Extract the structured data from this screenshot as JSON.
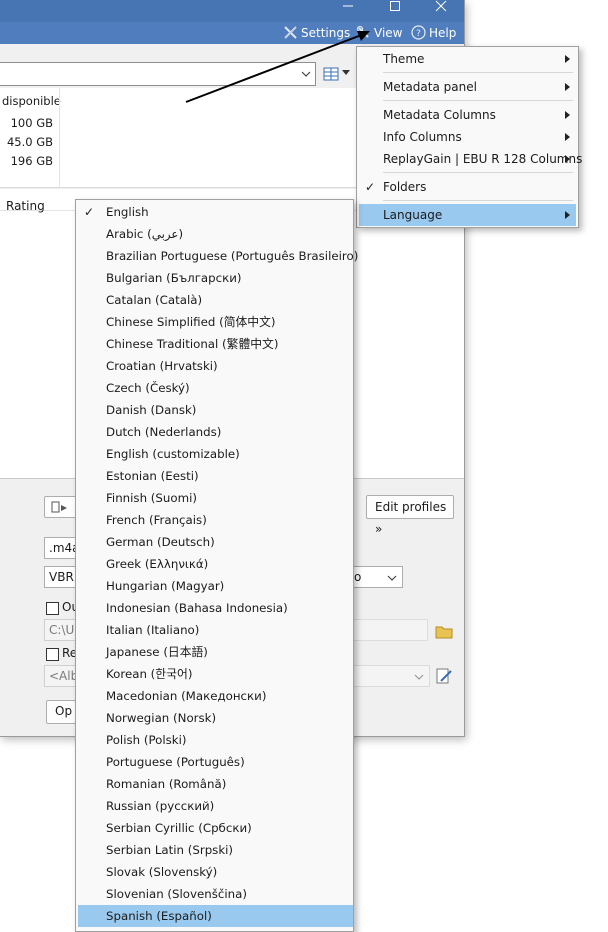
{
  "menubar": {
    "settings": "Settings",
    "view": "View",
    "help": "Help"
  },
  "drives": {
    "header": "disponible",
    "values": [
      "100 GB",
      "45.0 GB",
      "196 GB"
    ]
  },
  "list": {
    "rating_header": "Rating"
  },
  "bottom": {
    "edit_profiles": "Edit profiles »",
    "format_value": ".m4a",
    "mode_value": "VBR",
    "checkbox1_label": "Ou",
    "path_value": "C:\\U",
    "checkbox2_label": "Re",
    "pattern_value": "<Alb",
    "options_label": "Op",
    "mode2_value": "o"
  },
  "view_menu": {
    "items": [
      {
        "label": "Theme",
        "submenu": true
      },
      {
        "label": "Metadata panel",
        "submenu": true
      },
      {
        "label": "Metadata Columns",
        "submenu": true
      },
      {
        "label": "Info Columns",
        "submenu": true
      },
      {
        "label": "ReplayGain | EBU R 128 Columns",
        "submenu": true
      },
      {
        "label": "Folders",
        "checked": true
      },
      {
        "label": "Language",
        "submenu": true,
        "highlighted": true
      }
    ]
  },
  "language_menu": {
    "items": [
      {
        "label": "English",
        "checked": true
      },
      {
        "label": "Arabic (عربي)"
      },
      {
        "label": "Brazilian Portuguese (Português Brasileiro)"
      },
      {
        "label": "Bulgarian (Български)"
      },
      {
        "label": "Catalan (Català)"
      },
      {
        "label": "Chinese Simplified (简体中文)"
      },
      {
        "label": "Chinese Traditional (繁體中文)"
      },
      {
        "label": "Croatian (Hrvatski)"
      },
      {
        "label": "Czech (Český)"
      },
      {
        "label": "Danish (Dansk)"
      },
      {
        "label": "Dutch (Nederlands)"
      },
      {
        "label": "English (customizable)"
      },
      {
        "label": "Estonian (Eesti)"
      },
      {
        "label": "Finnish (Suomi)"
      },
      {
        "label": "French (Français)"
      },
      {
        "label": "German (Deutsch)"
      },
      {
        "label": "Greek (Ελληνικά)"
      },
      {
        "label": "Hungarian (Magyar)"
      },
      {
        "label": "Indonesian (Bahasa Indonesia)"
      },
      {
        "label": "Italian (Italiano)"
      },
      {
        "label": "Japanese (日本語)"
      },
      {
        "label": "Korean (한국어)"
      },
      {
        "label": "Macedonian (Македонски)"
      },
      {
        "label": "Norwegian (Norsk)"
      },
      {
        "label": "Polish (Polski)"
      },
      {
        "label": "Portuguese (Português)"
      },
      {
        "label": "Romanian (Română)"
      },
      {
        "label": "Russian (русский)"
      },
      {
        "label": "Serbian Cyrillic (Србски)"
      },
      {
        "label": "Serbian Latin (Srpski)"
      },
      {
        "label": "Slovak (Slovenský)"
      },
      {
        "label": "Slovenian (Slovenščina)"
      },
      {
        "label": "Spanish (Español)",
        "highlighted": true
      }
    ]
  },
  "colors": {
    "titlebar": "#4774b3",
    "menubar": "#4f7dbd",
    "highlight": "#99c9ef"
  }
}
